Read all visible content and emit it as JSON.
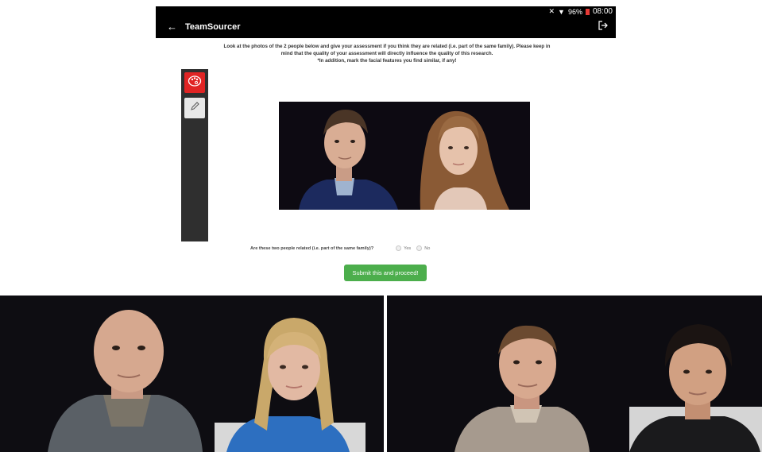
{
  "app": {
    "title": "TeamSourcer",
    "status": {
      "battery_text": "96%",
      "time": "08:00"
    }
  },
  "instructions": {
    "line1": "Look at the photos of the 2 people below and give your assessment if you think they are related (i.e. part of the same family). Please keep in",
    "line2": "mind that the quality of your assessment will directly influence the quality of this research.",
    "line3": "*In addition, mark the facial features you find similar, if any!"
  },
  "toolbar": {
    "tools": [
      {
        "icon": "palette-icon",
        "active": true
      },
      {
        "icon": "pencil-icon",
        "active": false
      }
    ]
  },
  "question": {
    "text": "Are these two people related (i.e. part of the same family)?",
    "options": [
      "Yes",
      "No"
    ]
  },
  "submit": {
    "label": "Submit this and proceed!"
  },
  "colors": {
    "appbar": "#000000",
    "accent_red": "#e02424",
    "submit_green": "#4cae4c",
    "toolbar": "#2f2f2f"
  }
}
